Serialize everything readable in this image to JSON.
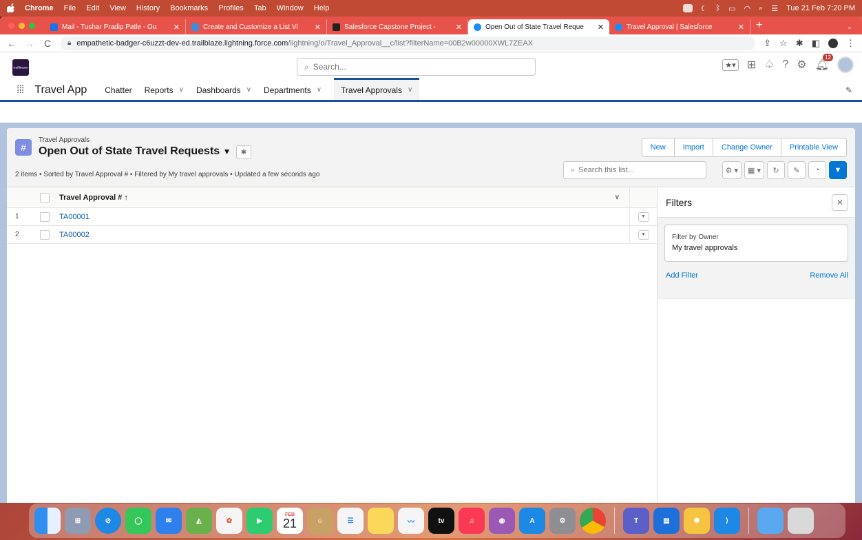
{
  "menubar": {
    "items": [
      "Chrome",
      "File",
      "Edit",
      "View",
      "History",
      "Bookmarks",
      "Profiles",
      "Tab",
      "Window",
      "Help"
    ],
    "clock": "Tue 21 Feb  7:20 PM"
  },
  "browser": {
    "tabs": [
      {
        "label": "Mail - Tushar Pradip Patle - Ou",
        "color": "#1a73e8"
      },
      {
        "label": "Create and Customize a List Vi",
        "color": "#3a8dde"
      },
      {
        "label": "Salesforce Capstone Project - ",
        "color": "#222222"
      },
      {
        "label": "Open Out of State Travel Reque",
        "color": "#1d8cf8"
      },
      {
        "label": "Travel Approval | Salesforce",
        "color": "#1d8cf8"
      }
    ],
    "url_host": "empathetic-badger-c6uzzt-dev-ed.trailblaze.lightning.force.com",
    "url_path": "/lightning/o/Travel_Approval__c/list?filterName=00B2w00000XWL7ZEAX"
  },
  "sf": {
    "logo_text": "trailblazer",
    "search_placeholder": "Search...",
    "notification_count": "12",
    "app_name": "Travel App",
    "nav": [
      {
        "label": "Chatter",
        "has_menu": false
      },
      {
        "label": "Reports",
        "has_menu": true
      },
      {
        "label": "Dashboards",
        "has_menu": true
      },
      {
        "label": "Departments",
        "has_menu": true
      },
      {
        "label": "Travel Approvals",
        "has_menu": true
      }
    ]
  },
  "list_view": {
    "object_label": "Travel Approvals",
    "title": "Open Out of State Travel Requests",
    "info": "2 items • Sorted by Travel Approval # • Filtered by My travel approvals • Updated a few seconds ago",
    "buttons": [
      "New",
      "Import",
      "Change Owner",
      "Printable View"
    ],
    "search_placeholder": "Search this list...",
    "column_header": "Travel Approval #",
    "rows": [
      {
        "num": "1",
        "name": "TA00001"
      },
      {
        "num": "2",
        "name": "TA00002"
      }
    ]
  },
  "filters": {
    "title": "Filters",
    "filter_label": "Filter by Owner",
    "filter_value": "My travel approvals",
    "add_filter": "Add Filter",
    "remove_all": "Remove All"
  },
  "dock": {
    "calendar_month": "FEB",
    "calendar_day": "21",
    "tv_label": "tv"
  }
}
